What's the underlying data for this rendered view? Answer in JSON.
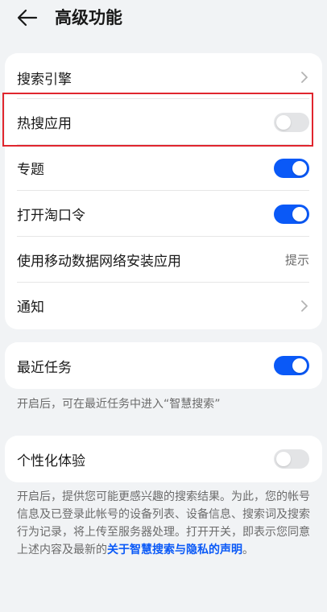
{
  "header": {
    "title": "高级功能",
    "back_icon": "back-arrow-icon"
  },
  "card1": {
    "items": [
      {
        "label": "搜索引擎",
        "control": "chevron"
      },
      {
        "label": "热搜应用",
        "control": "toggle",
        "on": false
      },
      {
        "label": "专题",
        "control": "toggle",
        "on": true
      },
      {
        "label": "打开淘口令",
        "control": "toggle",
        "on": true
      },
      {
        "label": "使用移动数据网络安装应用",
        "control": "hint",
        "hint": "提示"
      },
      {
        "label": "通知",
        "control": "chevron"
      }
    ]
  },
  "card2": {
    "label": "最近任务",
    "on": true
  },
  "note1": "开启后，可在最近任务中进入“智慧搜索”",
  "card3": {
    "label": "个性化体验",
    "on": false
  },
  "note2": {
    "text": "开启后，提供您可能更感兴趣的搜索结果。为此，您的帐号信息及已登录此帐号的设备列表、设备信息、搜索词及搜索行为记录，将上传至服务器处理。打开开关，即表示您同意上述内容及最新的",
    "link": "关于智慧搜索与隐私的声明",
    "suffix": "。"
  },
  "colors": {
    "accent": "#0a59f7",
    "highlight": "#e0262e",
    "background": "#f1f3f5"
  }
}
